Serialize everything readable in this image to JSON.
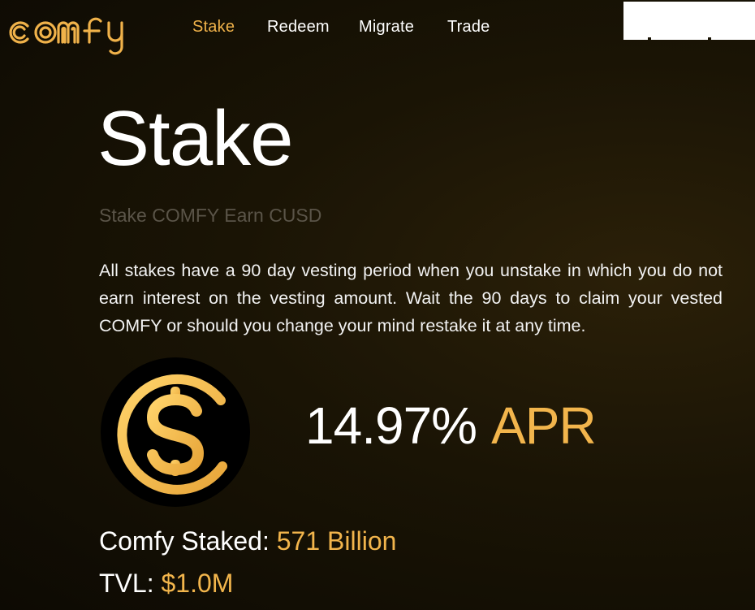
{
  "brand": {
    "logo_text": "comfy",
    "accent_color": "#f0b24a"
  },
  "nav": {
    "items": [
      {
        "label": "Stake",
        "active": true
      },
      {
        "label": "Redeem",
        "active": false
      },
      {
        "label": "Migrate",
        "active": false
      },
      {
        "label": "Trade",
        "active": false
      }
    ]
  },
  "page": {
    "title": "Stake",
    "subtitle": "Stake COMFY Earn CUSD",
    "description": "All stakes have a 90 day vesting period when you unstake in which you do not earn interest on the vesting amount. Wait the 90 days to claim your vested COMFY or should you change your mind restake it at any time."
  },
  "apr": {
    "value": "14.97%",
    "unit": "APR"
  },
  "stats": {
    "staked_label": "Comfy Staked: ",
    "staked_value": "571 Billion",
    "tvl_label": "TVL: ",
    "tvl_value": "$1.0M"
  },
  "icons": {
    "coin": "dollar-coin-icon"
  }
}
